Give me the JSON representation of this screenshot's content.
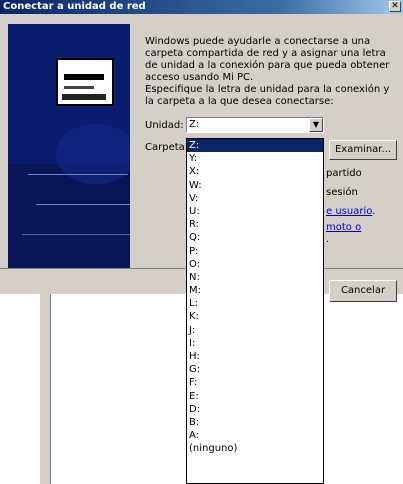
{
  "window": {
    "title": "Conectar a unidad de red",
    "close_glyph": "✕"
  },
  "intro_text": "Windows puede ayudarle a conectarse a una carpeta compartida de red y a asignar una letra de unidad a la conexión para que pueda obtener acceso usando Mi PC.",
  "instruction_text": "Especifique la letra de unidad para la conexión y la carpeta a la que desea conectarse:",
  "unit_label": "Unidad:",
  "unit_value": "Z:",
  "dropdown_arrow": "▼",
  "folder_label": "Carpeta:",
  "browse_label": "Examinar...",
  "obscured_fragments": {
    "partido": "partido",
    "sesion": "sesión",
    "usuario": "e usuario",
    "usuario_dot": ".",
    "remoto": "moto o",
    "dot2": "."
  },
  "cancel_label": "Cancelar",
  "dropdown_items": [
    "Z:",
    "Y:",
    "X:",
    "W:",
    "V:",
    "U:",
    "R:",
    "Q:",
    "P:",
    "O:",
    "N:",
    "M:",
    "L:",
    "K:",
    "J:",
    "I:",
    "H:",
    "G:",
    "F:",
    "E:",
    "D:",
    "B:",
    "A:",
    "(ninguno)"
  ],
  "selected_index": 0,
  "colors": {
    "selection": "#0a246a",
    "dialog_bg": "#d4d0c8",
    "panel": "#0a1c6e"
  }
}
